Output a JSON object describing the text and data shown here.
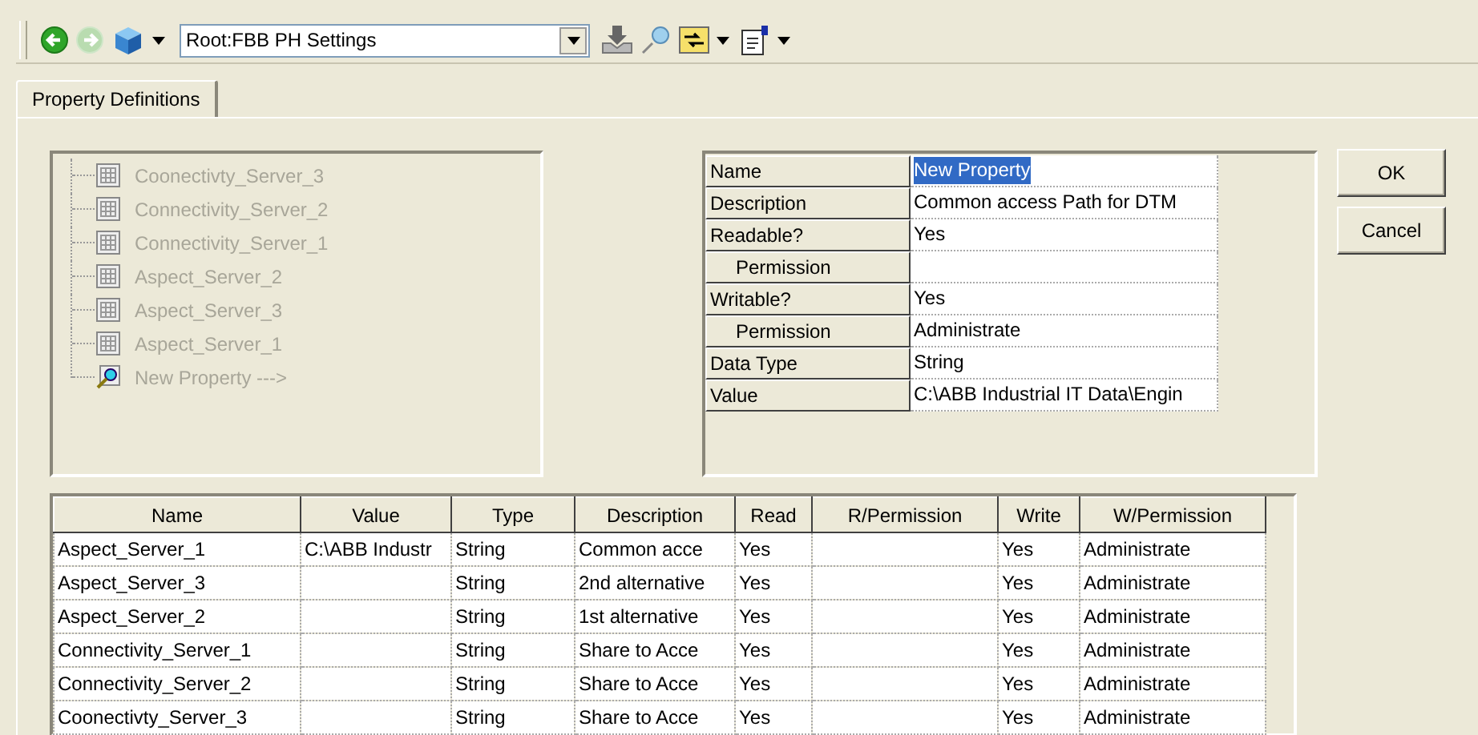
{
  "toolbar": {
    "buttons": [
      {
        "kind": "back",
        "disabled": false
      },
      {
        "kind": "forward",
        "disabled": true
      },
      {
        "kind": "cube",
        "disabled": false,
        "dropdown": true
      }
    ],
    "address": {
      "value": "Root:FBB PH Settings"
    },
    "tools": [
      {
        "kind": "tray"
      },
      {
        "kind": "pin"
      },
      {
        "kind": "swap",
        "dropdown": true
      },
      {
        "kind": "clipboard",
        "dropdown": true
      }
    ]
  },
  "tabs": [
    {
      "label": "Property Definitions",
      "selected": true
    }
  ],
  "tree": {
    "disabled": true,
    "items": [
      {
        "label": "Coonectivty_Server_3",
        "kind": "table"
      },
      {
        "label": "Connectivity_Server_2",
        "kind": "table"
      },
      {
        "label": "Connectivity_Server_1",
        "kind": "table"
      },
      {
        "label": "Aspect_Server_2",
        "kind": "table"
      },
      {
        "label": "Aspect_Server_3",
        "kind": "table"
      },
      {
        "label": "Aspect_Server_1",
        "kind": "table"
      },
      {
        "label": "New Property --->",
        "kind": "search"
      }
    ]
  },
  "properties": {
    "rows": [
      {
        "label": "Name",
        "value": "New Property",
        "kind": "field",
        "selected": true
      },
      {
        "label": "Description",
        "value": "Common access Path for DTM",
        "kind": "field",
        "selected": false
      },
      {
        "label": "Readable?",
        "value": "Yes",
        "kind": "field",
        "selected": false
      },
      {
        "label": "Permission",
        "kind": "sub",
        "selected": false
      },
      {
        "label": "Writable?",
        "value": "Yes",
        "kind": "field",
        "selected": false
      },
      {
        "label": "Permission",
        "value": "Administrate",
        "kind": "sub",
        "selected": false
      },
      {
        "label": "Data Type",
        "value": "String",
        "kind": "field",
        "selected": false
      },
      {
        "label": "Value",
        "value": "C:\\ABB Industrial IT Data\\Engin",
        "kind": "field",
        "selected": false
      }
    ]
  },
  "buttons": [
    "OK",
    "Cancel"
  ],
  "table": {
    "columns": [
      "Name",
      "Value",
      "Type",
      "Description",
      "Read",
      "R/Permission",
      "Write",
      "W/Permission"
    ],
    "rows": [
      [
        "Aspect_Server_1",
        "C:\\ABB Industr",
        "String",
        "Common acce",
        "Yes",
        "",
        "Yes",
        "Administrate"
      ],
      [
        "Aspect_Server_3",
        "",
        "String",
        "2nd alternative",
        "Yes",
        "",
        "Yes",
        "Administrate"
      ],
      [
        "Aspect_Server_2",
        "",
        "String",
        "1st alternative",
        "Yes",
        "",
        "Yes",
        "Administrate"
      ],
      [
        "Connectivity_Server_1",
        "",
        "String",
        "Share to Acce",
        "Yes",
        "",
        "Yes",
        "Administrate"
      ],
      [
        "Connectivity_Server_2",
        "",
        "String",
        "Share to Acce",
        "Yes",
        "",
        "Yes",
        "Administrate"
      ],
      [
        "Coonectivty_Server_3",
        "",
        "String",
        "Share to Acce",
        "Yes",
        "",
        "Yes",
        "Administrate"
      ]
    ]
  }
}
